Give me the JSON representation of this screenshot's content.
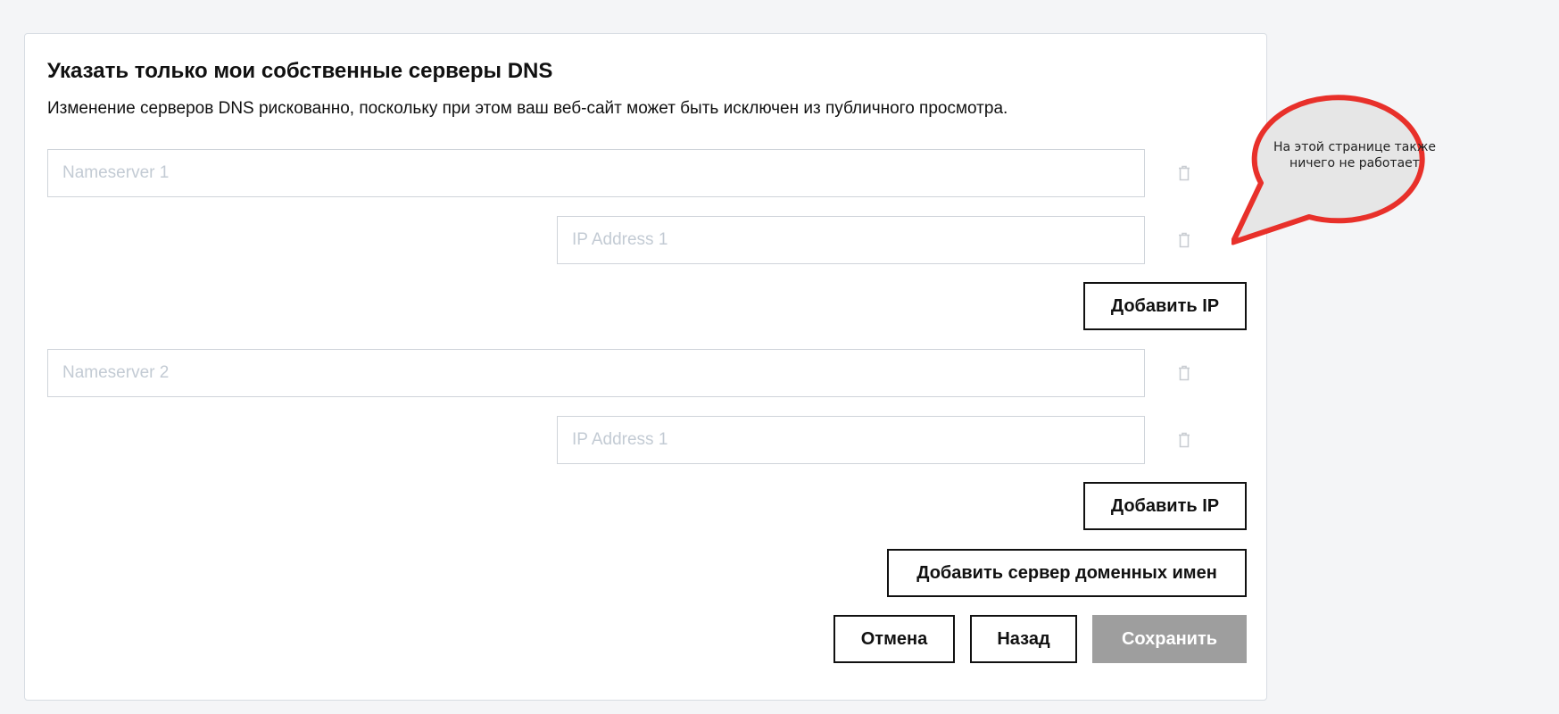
{
  "section": {
    "title": "Указать только мои собственные серверы DNS",
    "description": "Изменение серверов DNS рискованно, поскольку при этом ваш веб-сайт может быть исключен из публичного просмотра."
  },
  "nameservers": [
    {
      "placeholder": "Nameserver 1",
      "ips": [
        {
          "placeholder": "IP Address 1"
        }
      ],
      "add_ip_label": "Добавить IP"
    },
    {
      "placeholder": "Nameserver 2",
      "ips": [
        {
          "placeholder": "IP Address 1"
        }
      ],
      "add_ip_label": "Добавить IP"
    }
  ],
  "actions": {
    "add_nameserver_label": "Добавить сервер доменных имен",
    "cancel_label": "Отмена",
    "back_label": "Назад",
    "save_label": "Сохранить"
  },
  "annotation": {
    "text_line1": "На этой странице также",
    "text_line2": "ничего не работает"
  },
  "icons": {
    "delete": "trash-icon"
  },
  "colors": {
    "bubble_border": "#e8302a",
    "bubble_fill": "#e6e6e6",
    "save_disabled": "#9e9e9e",
    "placeholder": "#c3cbd4"
  }
}
